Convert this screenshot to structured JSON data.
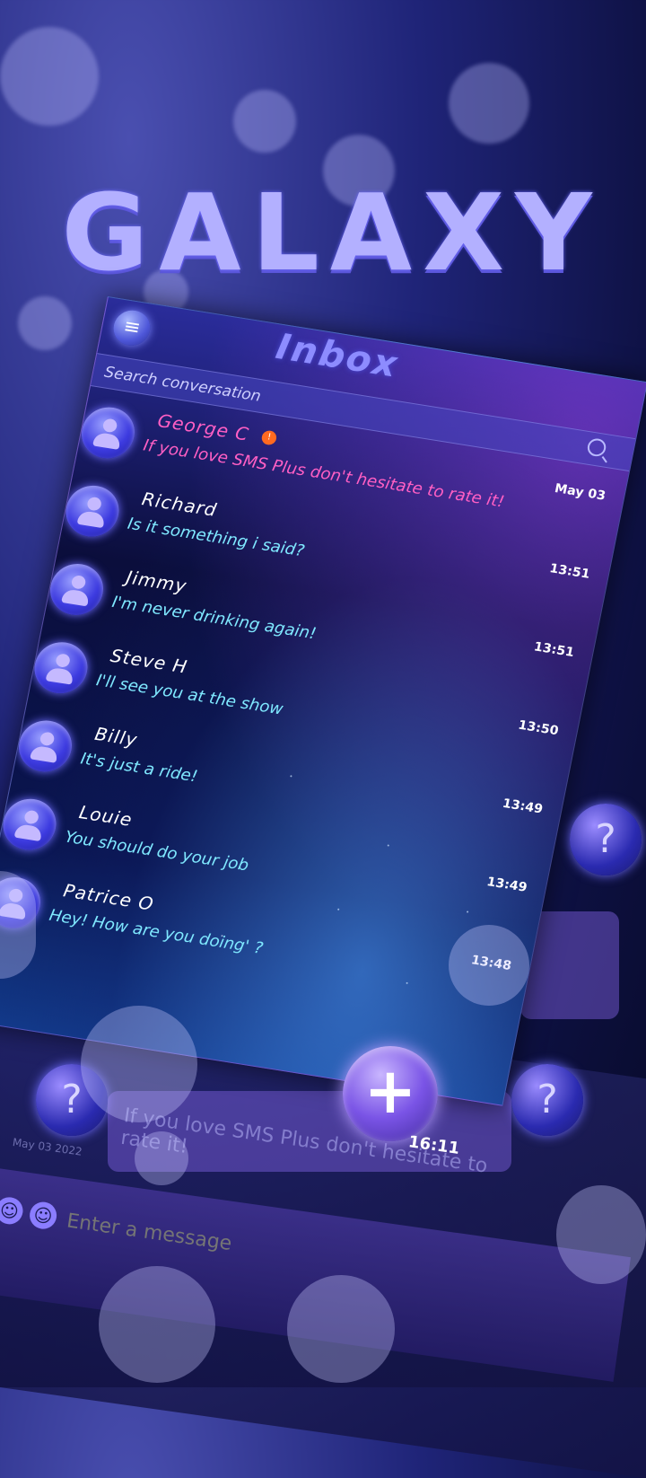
{
  "banner": {
    "title": "GALAXY"
  },
  "app": {
    "title": "Inbox",
    "menu_icon": "hamburger-icon",
    "search": {
      "placeholder": "Search conversation",
      "value": ""
    }
  },
  "conversations": [
    {
      "name": "George C",
      "preview": "If you love SMS Plus don't hesitate to rate it!",
      "time": "May 03",
      "unread": "!",
      "highlight": true
    },
    {
      "name": "Richard",
      "preview": "Is it something i said?",
      "time": "13:51"
    },
    {
      "name": "Jimmy",
      "preview": "I'm never drinking again!",
      "time": "13:51"
    },
    {
      "name": "Steve H",
      "preview": "I'll see you at the show",
      "time": "13:50"
    },
    {
      "name": "Billy",
      "preview": "It's just a ride!",
      "time": "13:49"
    },
    {
      "name": "Louie",
      "preview": "You should do your job",
      "time": "13:49"
    },
    {
      "name": "Patrice O",
      "preview": "Hey! How are you doing' ?",
      "time": "13:48"
    }
  ],
  "fab": {
    "icon": "plus-icon",
    "time": "16:11"
  },
  "background_chat": {
    "message": "If you love SMS Plus don't hesitate to rate it!",
    "input_placeholder": "Enter a message",
    "date": "May 03 2022"
  },
  "colors": {
    "accent": "#8d8cff",
    "highlight": "#ff5fc4",
    "preview": "#7fe8ff",
    "badge": "#ff6a20"
  }
}
